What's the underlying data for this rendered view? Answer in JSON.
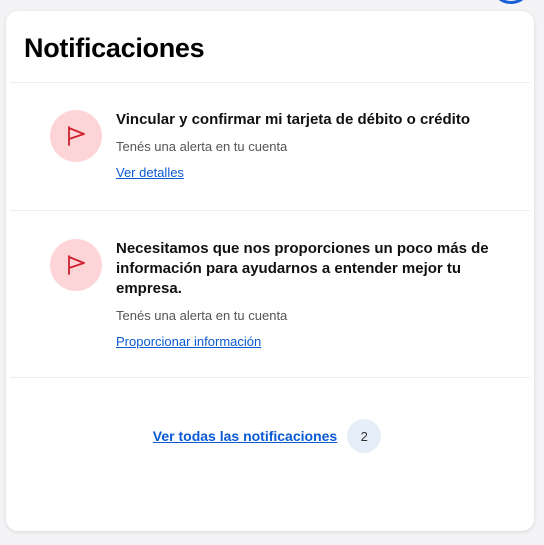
{
  "panel": {
    "title": "Notificaciones"
  },
  "notifications": [
    {
      "icon": "flag-icon",
      "title": "Vincular y confirmar mi tarjeta de débito o crédito",
      "subtitle": "Tenés una alerta en tu cuenta",
      "link_label": "Ver detalles"
    },
    {
      "icon": "flag-icon",
      "title": "Necesitamos que nos proporciones un poco más de información para ayudarnos a entender mejor tu empresa.",
      "subtitle": "Tenés una alerta en tu cuenta",
      "link_label": "Proporcionar información"
    }
  ],
  "footer": {
    "see_all_label": "Ver todas las notificaciones",
    "count": "2"
  },
  "colors": {
    "accent": "#0a5ad4",
    "icon_bg": "#fdd5d7",
    "icon_stroke": "#d0202e",
    "badge_bg": "#e6eef9"
  }
}
